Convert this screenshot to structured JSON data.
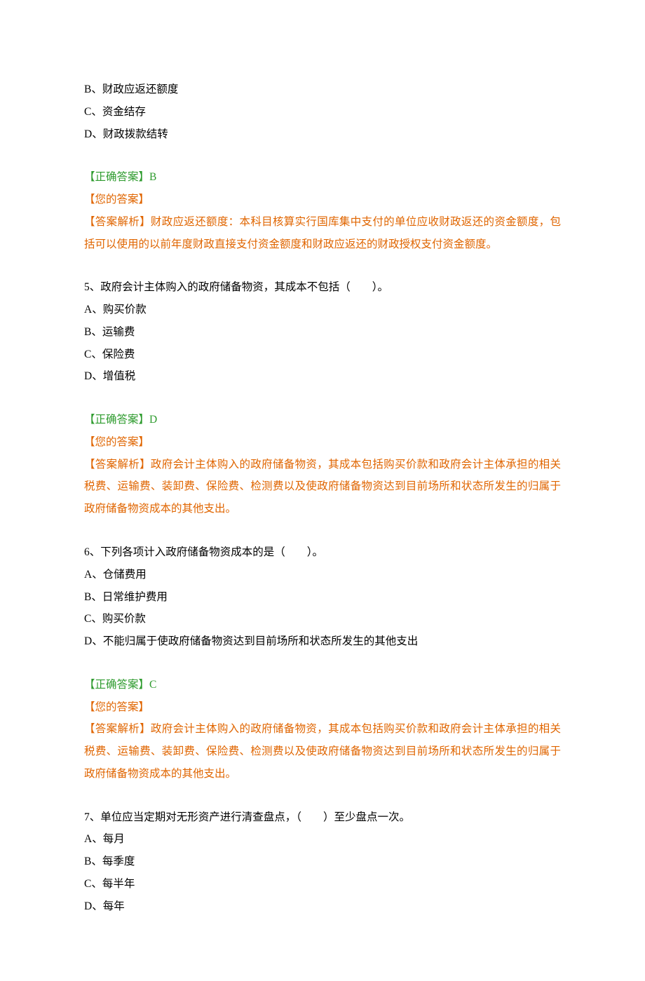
{
  "q4": {
    "opt_b": "B、财政应返还额度",
    "opt_c": "C、资金结存",
    "opt_d": "D、财政拨款结转",
    "correct": "【正确答案】B",
    "your": "【您的答案】",
    "explain": "【答案解析】财政应返还额度：本科目核算实行国库集中支付的单位应收财政返还的资金额度，包括可以使用的以前年度财政直接支付资金额度和财政应返还的财政授权支付资金额度。"
  },
  "q5": {
    "stem": "5、政府会计主体购入的政府储备物资，其成本不包括（　　）。",
    "opt_a": "A、购买价款",
    "opt_b": "B、运输费",
    "opt_c": "C、保险费",
    "opt_d": "D、增值税",
    "correct": "【正确答案】D",
    "your": "【您的答案】",
    "explain": "【答案解析】政府会计主体购入的政府储备物资，其成本包括购买价款和政府会计主体承担的相关税费、运输费、装卸费、保险费、检测费以及使政府储备物资达到目前场所和状态所发生的归属于政府储备物资成本的其他支出。"
  },
  "q6": {
    "stem": "6、下列各项计入政府储备物资成本的是（　　）。",
    "opt_a": "A、仓储费用",
    "opt_b": "B、日常维护费用",
    "opt_c": "C、购买价款",
    "opt_d": "D、不能归属于使政府储备物资达到目前场所和状态所发生的其他支出",
    "correct": "【正确答案】C",
    "your": "【您的答案】",
    "explain": "【答案解析】政府会计主体购入的政府储备物资，其成本包括购买价款和政府会计主体承担的相关税费、运输费、装卸费、保险费、检测费以及使政府储备物资达到目前场所和状态所发生的归属于政府储备物资成本的其他支出。"
  },
  "q7": {
    "stem": "7、单位应当定期对无形资产进行清查盘点，（　　）至少盘点一次。",
    "opt_a": "A、每月",
    "opt_b": "B、每季度",
    "opt_c": "C、每半年",
    "opt_d": "D、每年"
  }
}
